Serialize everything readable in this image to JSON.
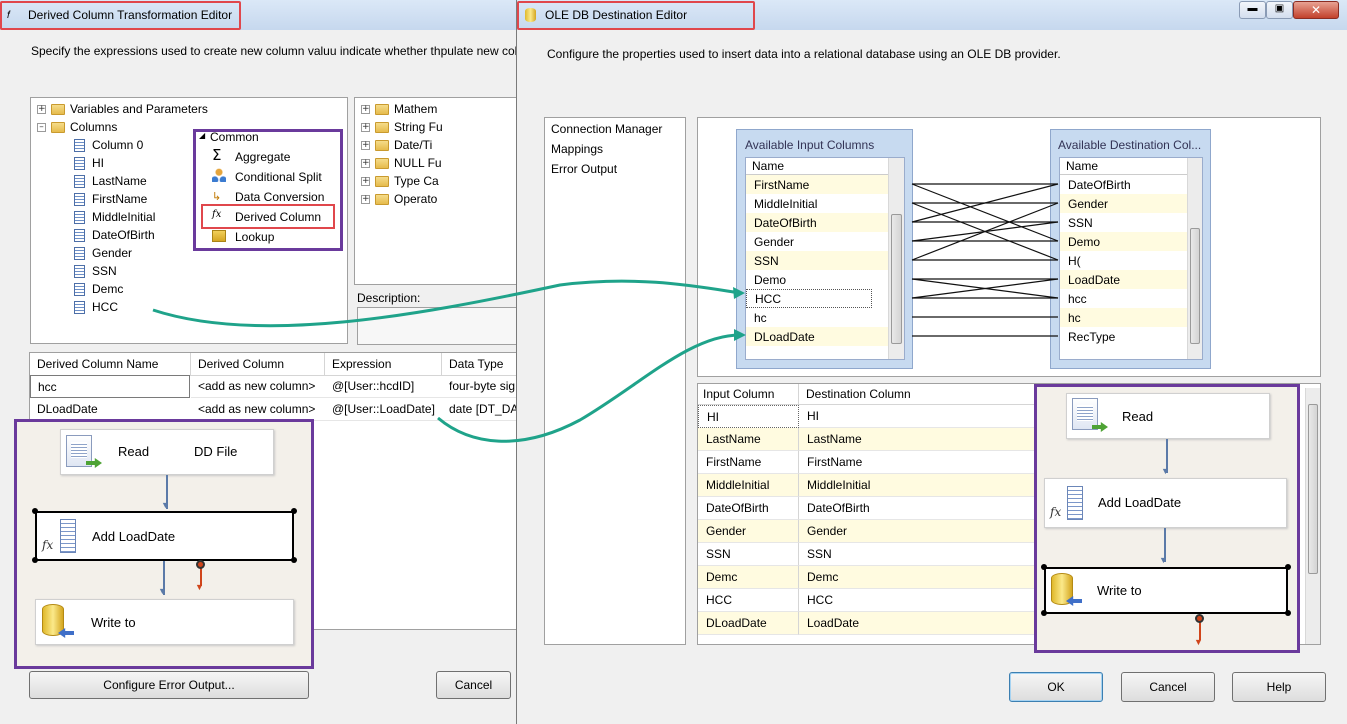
{
  "left_window": {
    "title": "Derived Column Transformation Editor",
    "description": "Specify the expressions used to create new column valuu indicate whether thpulate new col",
    "tree": {
      "variables": "Variables and Parameters",
      "columns": "Columns",
      "items": [
        "Column 0",
        "HI",
        "LastName",
        "FirstName",
        "MiddleInitial",
        "DateOfBirth",
        "Gender",
        "SSN",
        "Demc",
        "HCC"
      ]
    },
    "functions": [
      "Mathem",
      "String Fu",
      "Date/Ti",
      "NULL Fu",
      "Type Ca",
      "Operato"
    ],
    "description_label": "Description:",
    "grid": {
      "headers": [
        "Derived Column Name",
        "Derived Column",
        "Expression",
        "Data Type"
      ],
      "rows": [
        [
          "hcc",
          "<add as new column>",
          "@[User::hcdID]",
          "four-byte sig"
        ],
        [
          "DLoadDate",
          "<add as new column>",
          "@[User::LoadDate]",
          "date [DT_DA"
        ]
      ]
    },
    "configure_button": "Configure Error Output...",
    "cancel_button": "Cancel"
  },
  "toolbox_overlay": {
    "group": "Common",
    "items": [
      "Aggregate",
      "Conditional Split",
      "Data Conversion",
      "Derived Column",
      "Lookup"
    ]
  },
  "left_flow": {
    "read": "Read",
    "read_suffix": "DD File",
    "derived": "Add LoadDate",
    "write": "Write to"
  },
  "right_window": {
    "title": "OLE DB Destination Editor",
    "description": "Configure the properties used to insert data into a relational database using an OLE DB provider.",
    "nav": [
      "Connection Manager",
      "Mappings",
      "Error Output"
    ],
    "available_input": {
      "title": "Available Input Columns",
      "header": "Name",
      "items": [
        "FirstName",
        "MiddleInitial",
        "DateOfBirth",
        "Gender",
        "SSN",
        "Demo",
        "HCC",
        "hc",
        "DLoadDate"
      ]
    },
    "available_destination": {
      "title": "Available Destination Col...",
      "header": "Name",
      "items": [
        "DateOfBirth",
        "Gender",
        "SSN",
        "Demo",
        "H(",
        "LoadDate",
        "hcc",
        "hc",
        "RecType"
      ]
    },
    "mapping_grid": {
      "headers": [
        "Input Column",
        "Destination Column"
      ],
      "rows": [
        [
          "HI",
          "HI"
        ],
        [
          "LastName",
          "LastName"
        ],
        [
          "FirstName",
          "FirstName"
        ],
        [
          "MiddleInitial",
          "MiddleInitial"
        ],
        [
          "DateOfBirth",
          "DateOfBirth"
        ],
        [
          "Gender",
          "Gender"
        ],
        [
          "SSN",
          "SSN"
        ],
        [
          "Demc",
          "Demc"
        ],
        [
          "HCC",
          "HCC"
        ],
        [
          "DLoadDate",
          "LoadDate"
        ]
      ]
    },
    "ok_button": "OK",
    "cancel_button": "Cancel",
    "help_button": "Help"
  },
  "right_flow": {
    "read": "Read",
    "derived": "Add LoadDate",
    "write": "Write to"
  },
  "colors": {
    "highlight_red": "#e0474c",
    "callout_purple": "#6a3a9c",
    "connector_teal": "#1fa38a",
    "row_yellow": "#fffbe0"
  }
}
